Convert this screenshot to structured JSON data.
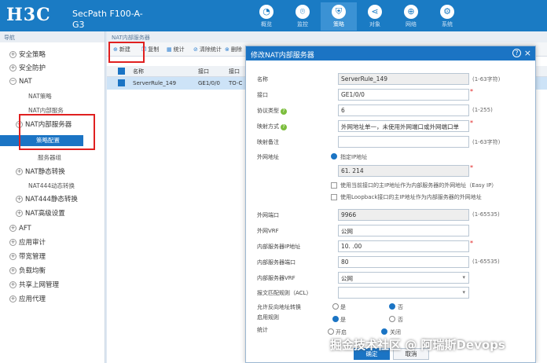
{
  "app": {
    "logo": "H3C",
    "product_line1": "SecPath F100-A-",
    "product_line2": "G3"
  },
  "topnav": [
    {
      "label": "概览",
      "icon": "gauge-icon"
    },
    {
      "label": "监控",
      "icon": "monitor-icon"
    },
    {
      "label": "策略",
      "icon": "shield-icon",
      "active": true
    },
    {
      "label": "对象",
      "icon": "share-icon"
    },
    {
      "label": "网络",
      "icon": "globe-icon"
    },
    {
      "label": "系统",
      "icon": "system-icon"
    }
  ],
  "left": {
    "header": "导航",
    "items": [
      {
        "label": "安全策略"
      },
      {
        "label": "安全防护"
      },
      {
        "label": "NAT"
      },
      {
        "label": "NAT策略"
      },
      {
        "label": "NAT内部服务"
      },
      {
        "label": "NAT内部服务器"
      },
      {
        "label": "策略配置"
      },
      {
        "label": "服务器组"
      },
      {
        "label": "NAT静态转换"
      },
      {
        "label": "NAT444动态转换"
      },
      {
        "label": "NAT444静态转换"
      },
      {
        "label": "NAT高级设置"
      },
      {
        "label": "AFT"
      },
      {
        "label": "应用审计"
      },
      {
        "label": "带宽管理"
      },
      {
        "label": "负载均衡"
      },
      {
        "label": "共享上网管理"
      },
      {
        "label": "应用代理"
      }
    ]
  },
  "main": {
    "title": "NAT内部服务器",
    "toolbar": {
      "new": "新建",
      "copy": "复制",
      "stats": "统计",
      "clear": "清除统计",
      "delete": "删除"
    },
    "columns": {
      "name": "名称",
      "iface": "接口",
      "type": "接口"
    },
    "row": {
      "name": "ServerRule_149",
      "iface": "GE1/0/0",
      "type": "TO-C"
    }
  },
  "dialog": {
    "title": "修改NAT内部服务器",
    "help": "?",
    "close": "×",
    "fields": {
      "name_label": "名称",
      "name_value": "ServerRule_149",
      "name_range": "(1-63字符)",
      "iface_label": "接口",
      "iface_value": "GE1/0/0",
      "proto_label": "协议类型",
      "proto_value": "6",
      "proto_range": "(1-255)",
      "map_label": "映射方式",
      "map_value": "外网地址单一，未使用外网端口或外网端口单",
      "remark_label": "映射备注",
      "remark_range": "(1-63字符)",
      "extaddr_label": "外网地址",
      "extaddr_radio": "指定IP地址",
      "extaddr_value": "61.        214",
      "opt1": "使用当前接口的主IP地址作为内部服务器的外网地址（Easy IP）",
      "opt2": "使用Loopback接口的主IP地址作为内部服务器的外网地址",
      "extport_label": "外网端口",
      "extport_value": "9966",
      "extport_range": "(1-65535)",
      "extvrf_label": "外网VRF",
      "extvrf_value": "公网",
      "inip_label": "内部服务器IP地址",
      "inip_value": "10.          .00",
      "inport_label": "内部服务器端口",
      "inport_value": "80",
      "inport_range": "(1-65535)",
      "invrf_label": "内部服务器VRF",
      "invrf_value": "公网",
      "acl_label": "报文匹配规则（ACL）",
      "reverse_label": "允许反向地址转换",
      "reverse_yes": "是",
      "reverse_no": "否",
      "enable_label": "启用规则",
      "enable_yes": "是",
      "enable_no": "否",
      "stats_label": "统计",
      "stats_on": "开启",
      "stats_off": "关闭"
    },
    "ok": "确定",
    "cancel": "取消"
  },
  "watermark": "掘金技术社区 @ 阿瑞斯Devops"
}
